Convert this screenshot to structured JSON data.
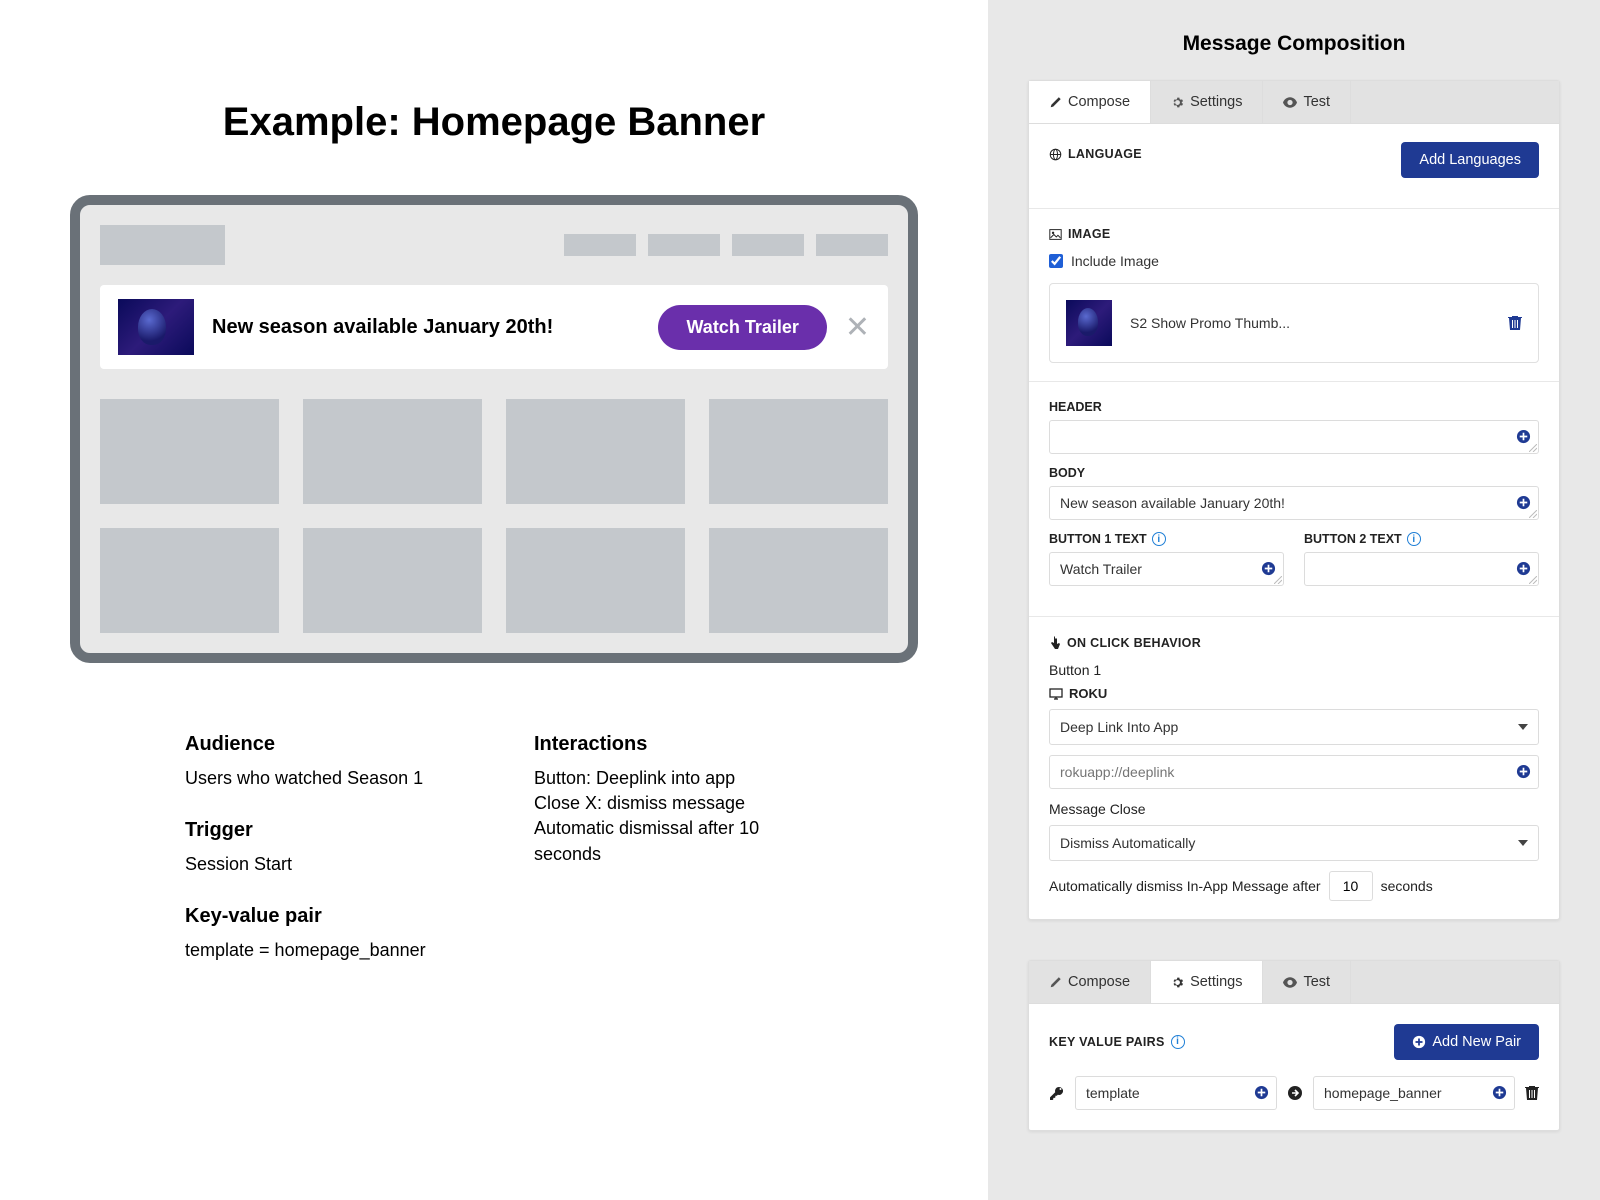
{
  "left": {
    "title": "Example: Homepage Banner",
    "banner_text": "New season available January 20th!",
    "banner_button": "Watch Trailer",
    "meta": {
      "audience_h": "Audience",
      "audience": "Users who watched Season 1",
      "trigger_h": "Trigger",
      "trigger": "Session Start",
      "kvp_h": "Key-value pair",
      "kvp": "template = homepage_banner",
      "interactions_h": "Interactions",
      "int1": "Button: Deeplink into app",
      "int2": "Close X: dismiss message",
      "int3": "Automatic dismissal after 10 seconds"
    }
  },
  "right": {
    "title": "Message Composition",
    "tabs": {
      "compose": "Compose",
      "settings": "Settings",
      "test": "Test"
    },
    "lang_label": "LANGUAGE",
    "add_languages": "Add Languages",
    "image_label": "IMAGE",
    "include_image": "Include Image",
    "image_name": "S2 Show Promo Thumb...",
    "header_label": "HEADER",
    "header_value": "",
    "body_label": "BODY",
    "body_value": "New season available January 20th!",
    "btn1_label": "BUTTON 1 TEXT",
    "btn1_value": "Watch Trailer",
    "btn2_label": "BUTTON 2 TEXT",
    "btn2_value": "",
    "onclick_label": "ON CLICK BEHAVIOR",
    "button1_sub": "Button 1",
    "roku_label": "ROKU",
    "roku_select": "Deep Link Into App",
    "deeplink_placeholder": "rokuapp://deeplink",
    "message_close_label": "Message Close",
    "dismiss_select": "Dismiss Automatically",
    "dismiss_pre": "Automatically dismiss In-App Message after",
    "dismiss_value": "10",
    "dismiss_post": "seconds",
    "kvp_label": "KEY VALUE PAIRS",
    "add_pair": "Add New Pair",
    "kvp_key": "template",
    "kvp_value": "homepage_banner"
  }
}
